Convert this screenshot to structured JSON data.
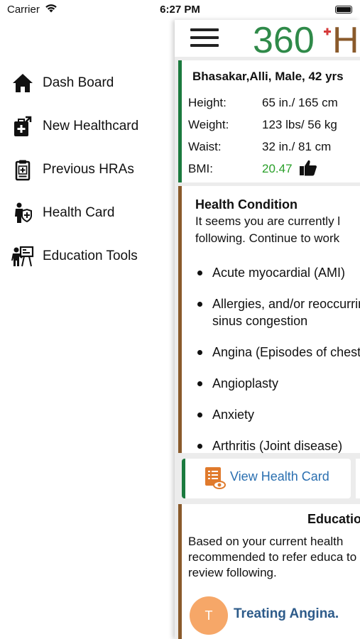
{
  "status_bar": {
    "carrier": "Carrier",
    "time": "6:27 PM"
  },
  "menu": {
    "items": [
      {
        "label": "Dash Board",
        "icon": "home-icon"
      },
      {
        "label": "New Healthcard",
        "icon": "new-healthcard-icon"
      },
      {
        "label": "Previous HRAs",
        "icon": "clipboard-icon"
      },
      {
        "label": "Health Card",
        "icon": "health-card-person-icon"
      },
      {
        "label": "Education Tools",
        "icon": "education-tools-icon"
      }
    ]
  },
  "header": {
    "logo_text": "360",
    "logo_suffix": "H"
  },
  "profile": {
    "name": "Bhasakar,Alli, Male, 42 yrs",
    "height_label": "Height:",
    "height_value": "65 in./ 165 cm",
    "weight_label": "Weight:",
    "weight_value": "123 lbs/ 56 kg",
    "waist_label": "Waist:",
    "waist_value": "32 in./ 81 cm",
    "bmi_label": "BMI:",
    "bmi_value": "20.47"
  },
  "health_condition": {
    "title": "Health Condition",
    "description_line1": "It seems you are currently l",
    "description_line2": "following. Continue to work",
    "items": [
      "Acute myocardial (AMI)",
      "Allergies, and/or reoccurring sinus congestion",
      "Angina (Episodes of chest pain)",
      "Angioplasty",
      "Anxiety",
      "Arthritis (Joint disease)"
    ]
  },
  "view_health_card": {
    "label": "View Health Card"
  },
  "education": {
    "title": "Educatio",
    "description": "Based on your current health recommended to refer educa to review following.",
    "topic_initial": "T",
    "topic_label": "Treating Angina."
  },
  "colors": {
    "accent_green": "#1b7a3e",
    "accent_brown": "#8a5a2b",
    "bmi_green": "#2aa02a",
    "link_blue": "#2a6fb0",
    "logo_green": "#2f8a49",
    "logo_red": "#d63a3a",
    "avatar_orange": "#f6a768"
  }
}
